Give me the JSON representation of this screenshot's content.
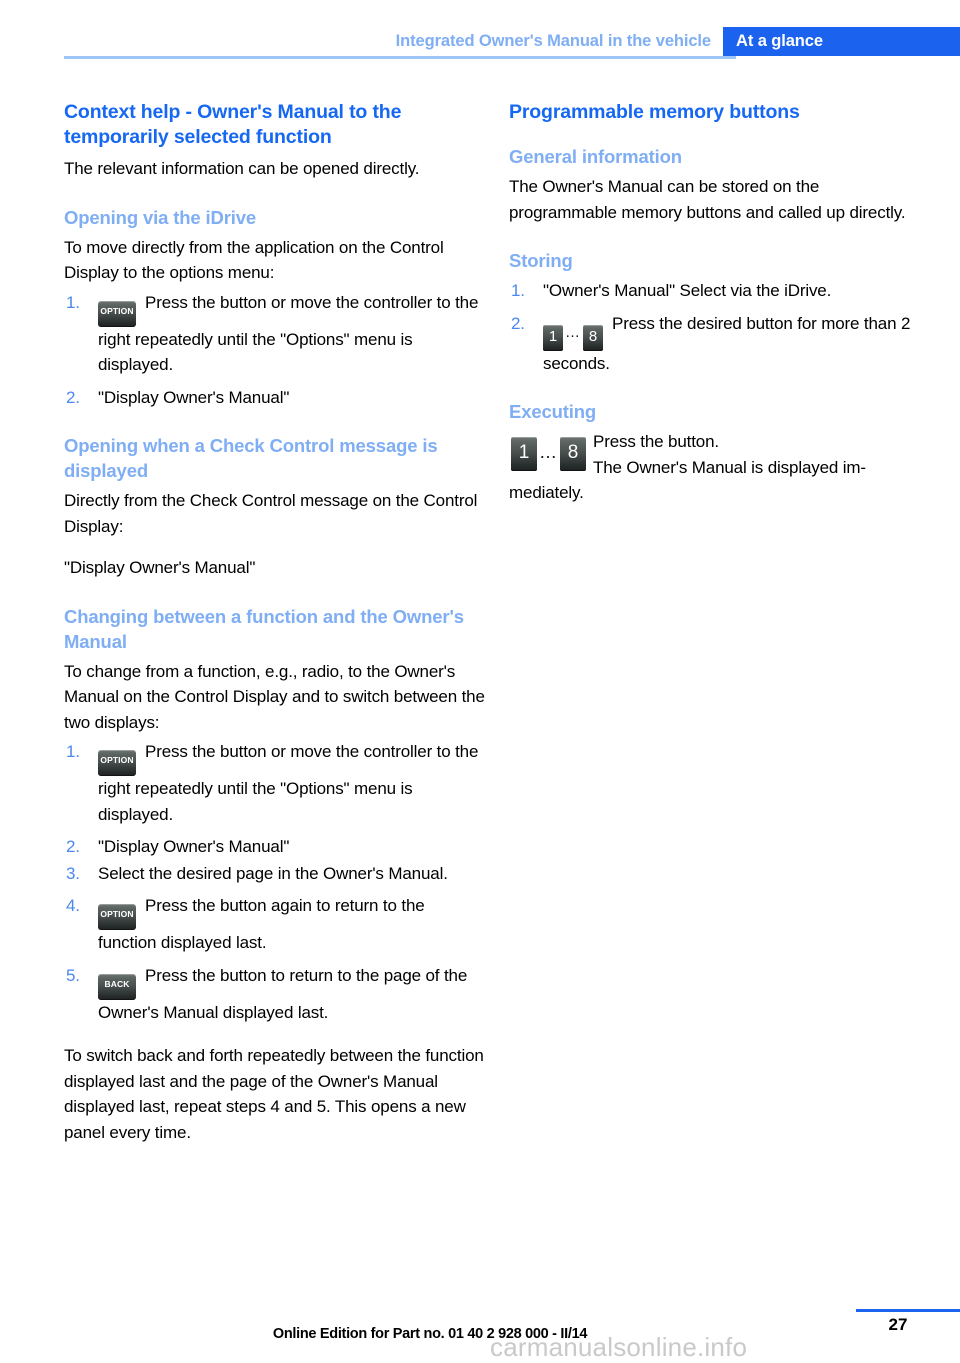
{
  "header": {
    "chapter": "Integrated Owner's Manual in the vehicle",
    "section": "At a glance"
  },
  "left_column": {
    "title": "Context help - Owner's Manual to the temporarily selected function",
    "intro": "The relevant information can be opened directly.",
    "section_idrive": {
      "heading": "Opening via the iDrive",
      "lead": "To move directly from the application on the Control Display to the options menu:",
      "steps": [
        {
          "num": "1.",
          "icon": "OPTION",
          "text": "Press the button or move the controller to the right repeatedly until the \"Options\" menu is displayed."
        },
        {
          "num": "2.",
          "icon": "",
          "text": "\"Display Owner's Manual\""
        }
      ]
    },
    "section_check_control": {
      "heading": "Opening when a Check Control message is displayed",
      "lead": "Directly from the Check Control message on the Control Display:",
      "quote": "\"Display Owner's Manual\""
    },
    "section_changing": {
      "heading": "Changing between a function and the Owner's Manual",
      "lead": "To change from a function, e.g., radio, to the Owner's Manual on the Control Display and to switch between the two displays:",
      "steps": [
        {
          "num": "1.",
          "icon": "OPTION",
          "text": "Press the button or move the controller to the right repeatedly until the \"Options\" menu is displayed."
        },
        {
          "num": "2.",
          "icon": "",
          "text": "\"Display Owner's Manual\""
        },
        {
          "num": "3.",
          "icon": "",
          "text": "Select the desired page in the Owner's Manual."
        },
        {
          "num": "4.",
          "icon": "OPTION",
          "text": "Press the button again to return to the function displayed last."
        },
        {
          "num": "5.",
          "icon": "BACK",
          "text": "Press the button to return to the page of the Owner's Manual displayed last."
        }
      ],
      "closing": "To switch back and forth repeatedly between the function displayed last and the page of the Owner's Manual displayed last, repeat steps 4 and 5. This opens a new panel every time."
    }
  },
  "right_column": {
    "title": "Programmable memory buttons",
    "section_general": {
      "heading": "General information",
      "text": "The Owner's Manual can be stored on the programmable memory buttons and called up directly."
    },
    "section_storing": {
      "heading": "Storing",
      "steps": [
        {
          "num": "1.",
          "text": "\"Owner's Manual\" Select via the iDrive."
        },
        {
          "num": "2.",
          "mem_from": "1",
          "mem_dots": "…",
          "mem_to": "8",
          "text": "Press the desired button for more than 2 seconds."
        }
      ]
    },
    "section_executing": {
      "heading": "Executing",
      "mem_from": "1",
      "mem_dots": "…",
      "mem_to": "8",
      "line1": "Press the button.",
      "line2": "The Owner's Manual is displayed im-",
      "line3": "mediately."
    }
  },
  "footer": {
    "edition": "Online Edition for Part no. 01 40 2 928 000 - II/14",
    "page_number": "27",
    "watermark": "carmanualsonline.info"
  }
}
